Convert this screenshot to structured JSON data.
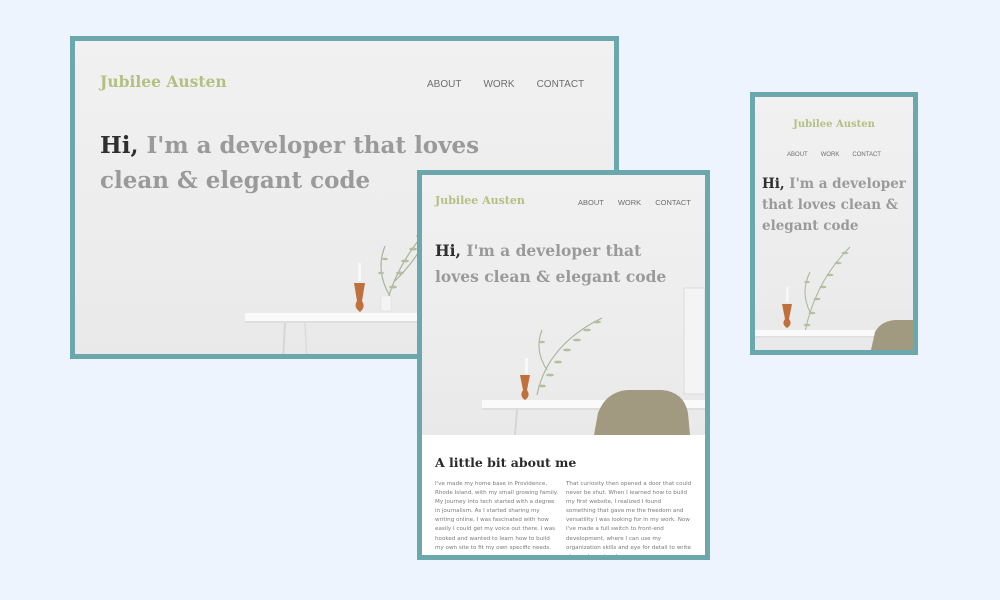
{
  "site": {
    "logo": "Jubilee Austen",
    "nav": [
      "ABOUT",
      "WORK",
      "CONTACT"
    ],
    "headline_hi": "Hi,",
    "headline_rest": "I'm a developer that loves clean & elegant code"
  },
  "about": {
    "title": "A little bit about me",
    "col1": "I've made my home base in Providence, Rhode Island, with my small growing family. My journey into tech started with a degree in journalism. As I started sharing my writing online, I was fascinated with how easily I could get my voice out there. I was hooked and wanted to learn how to build my own site to fit my own specific needs.",
    "col2": "That curiosity then opened a door that could never be shut. When I learned how to build my first website, I realized I found something that gave me the freedom and versatility I was looking for in my work. Now I've made a full switch to front-end development, where I can use my organization skills and eye for detail to write clean, elegant code."
  },
  "colors": {
    "frame": "#6aa8ad",
    "logo": "#b4c081",
    "headline": "#9a9a9a",
    "headline_hi": "#2f2f2f",
    "background": "#eef4fd"
  }
}
